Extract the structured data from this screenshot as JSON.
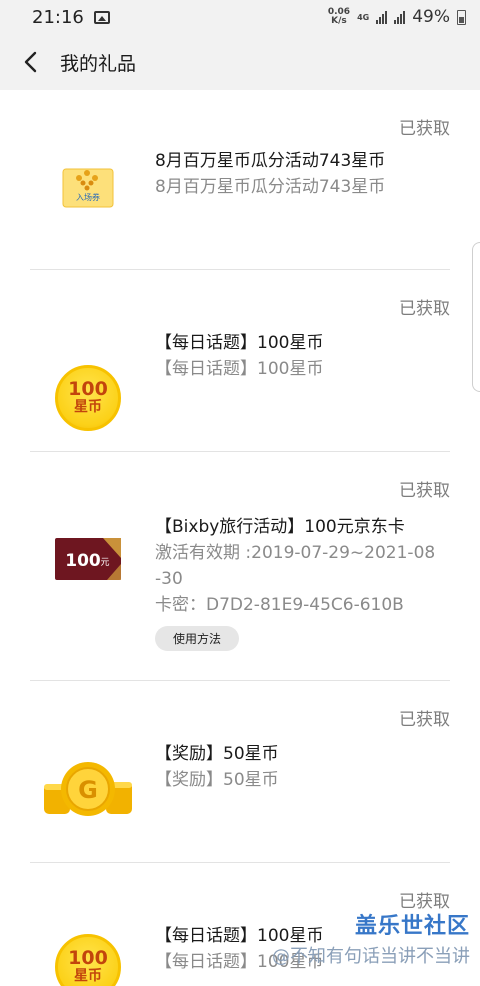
{
  "status_bar": {
    "time": "21:16",
    "net_speed_value": "0.06",
    "net_speed_unit": "K/s",
    "network_type": "4G",
    "battery_percent": "49%"
  },
  "app_bar": {
    "title": "我的礼品"
  },
  "gifts": [
    {
      "status": "已获取",
      "title": "8月百万星币瓜分活动743星币",
      "subtitle": "8月百万星币瓜分活动743星币",
      "image_label": "入场券"
    },
    {
      "status": "已获取",
      "title": "【每日话题】100星币",
      "subtitle": "【每日话题】100星币",
      "coin_amount": "100",
      "coin_unit": "星币"
    },
    {
      "status": "已获取",
      "title": "【Bixby旅行活动】100元京东卡",
      "validity": "激活有效期 :2019-07-29~2021-08-30",
      "card_code": "卡密：D7D2-81E9-45C6-610B",
      "button_label": "使用方法",
      "card_value": "100",
      "card_unit": "元"
    },
    {
      "status": "已获取",
      "title": "【奖励】50星币",
      "subtitle": "【奖励】50星币",
      "coin_letter": "G"
    },
    {
      "status": "已获取",
      "title": "【每日话题】100星币",
      "subtitle": "【每日话题】100星币",
      "coin_amount": "100",
      "coin_unit": "星币"
    }
  ],
  "watermark": {
    "site": "盖乐世社区",
    "author": "@不知有句话当讲不当讲"
  },
  "colors": {
    "bar_bg": "#f2f2f2",
    "status_text": "#7d7d7d",
    "coin_gold": "#fcd118",
    "watermark_blue": "#3777c8"
  }
}
